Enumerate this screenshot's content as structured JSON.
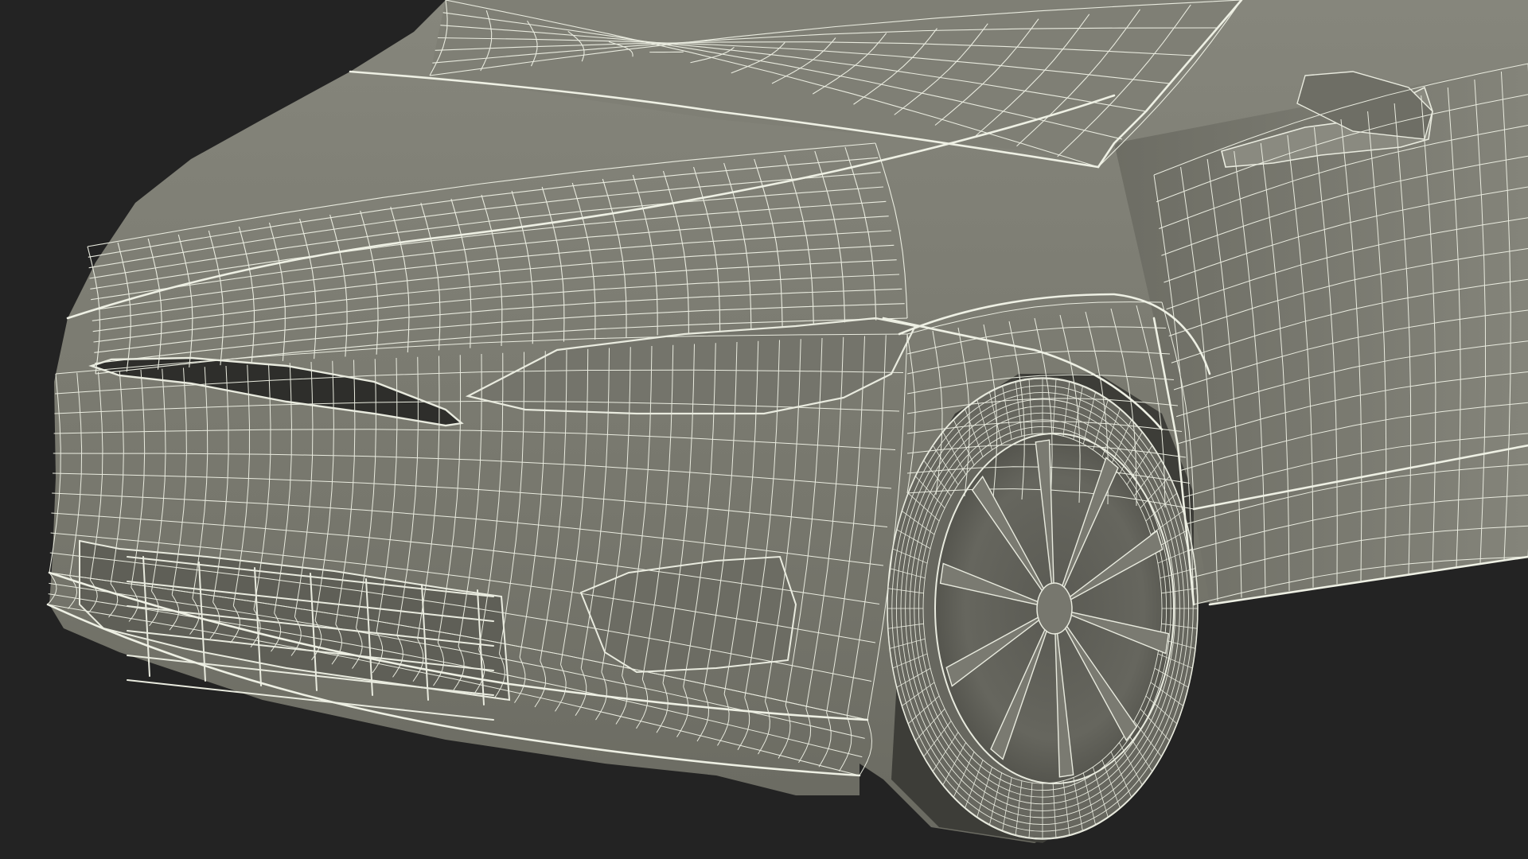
{
  "scene": {
    "subject": "car-front-wireframe-render",
    "colors": {
      "background": "#232323",
      "body": "#7a7a70",
      "body_shade": "#5e5e56",
      "body_highlight": "#8a8a80",
      "wire": "#e9ebdf",
      "wire_dark": "#3a3a36",
      "tire": "#6a6a62"
    }
  }
}
